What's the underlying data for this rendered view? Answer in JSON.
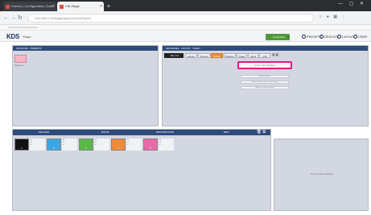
{
  "browser": {
    "tabs": [
      {
        "label": "Kramer | Configuration | Data",
        "active": false
      },
      {
        "label": "VIA Stage",
        "active": true
      }
    ],
    "url": "192.168.0.10/stage/app/control/#/layout",
    "bookmarks": "Apps   Kramer   Settings   Docs"
  },
  "app": {
    "logo": "KDS",
    "logo_suffix": "Stage",
    "top_button": "Connected",
    "top_button_tail": "▾",
    "header_items": [
      "PRESETS",
      "DEVICES",
      "LAYOUT",
      "USER"
    ]
  },
  "sources_panel": {
    "tabs": [
      "SOURCES",
      "PRESETS"
    ],
    "thumb_label": "Source 1"
  },
  "controls_panel": {
    "tabs": [
      "ADVANCED",
      "LAYOUT",
      "VIDEO"
    ],
    "selected": "Win 1x1",
    "tools": [
      "Layout",
      "Source",
      "Rotate",
      "Restore",
      "Swap",
      "Send"
    ],
    "zoom": "100",
    "highlight_button": "Add a new Window",
    "rows": [
      "Remove window",
      "Add a clone of source to this Layout",
      "Add new Layout to Layout"
    ]
  },
  "destinations_panel": {
    "columns": [
      "DEVICES",
      "ROOM",
      "DESTINATIONS",
      "EDIT"
    ],
    "tiles": [
      {
        "color": "#111111",
        "label": "1"
      },
      {
        "color": "#3aa7e3",
        "label": "2"
      },
      {
        "color": "#57b947",
        "label": "3"
      },
      {
        "color": "#ee8a3a",
        "label": "4"
      },
      {
        "color": "#e86aa8",
        "label": "5"
      }
    ]
  },
  "preview_panel": {
    "label": "No preview available"
  },
  "colors": {
    "accent": "#2f4b7c",
    "highlight": "#e5197f",
    "panel": "#d3d7e1"
  }
}
